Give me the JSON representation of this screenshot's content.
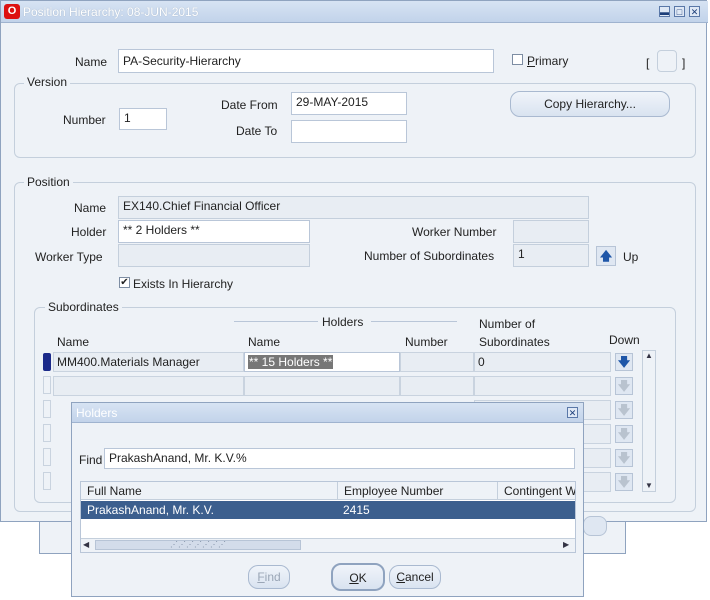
{
  "window": {
    "title": "Position Hierarchy: 08-JUN-2015"
  },
  "header": {
    "name_label": "Name",
    "name_value": "PA-Security-Hierarchy",
    "primary_label": "Primary",
    "primary_checked": false,
    "bracket_open": "[",
    "bracket_close": "]"
  },
  "version": {
    "title": "Version",
    "number_label": "Number",
    "number_value": "1",
    "date_from_label": "Date From",
    "date_from_value": "29-MAY-2015",
    "date_to_label": "Date To",
    "date_to_value": "",
    "copy_button": "Copy Hierarchy..."
  },
  "position": {
    "title": "Position",
    "name_label": "Name",
    "name_value": "EX140.Chief Financial Officer",
    "holder_label": "Holder",
    "holder_value": "** 2 Holders **",
    "worker_number_label": "Worker Number",
    "worker_number_value": "",
    "worker_type_label": "Worker Type",
    "worker_type_value": "",
    "subordinates_count_label": "Number of Subordinates",
    "subordinates_count_value": "1",
    "up_label": "Up",
    "exists_label": "Exists In Hierarchy",
    "exists_checked": true
  },
  "subordinates": {
    "title": "Subordinates",
    "holders_header": "Holders",
    "col_name": "Name",
    "col_holder_name": "Name",
    "col_number": "Number",
    "col_subs_line1": "Number of",
    "col_subs_line2": "Subordinates",
    "col_down": "Down",
    "rows": [
      {
        "name": "MM400.Materials Manager",
        "holder": "** 15 Holders **",
        "number": "",
        "subs": "0"
      }
    ]
  },
  "holders_dialog": {
    "title": "Holders",
    "find_label": "Find",
    "find_value": "PrakashAnand, Mr. K.V.%",
    "columns": [
      "Full Name",
      "Employee Number",
      "Contingent W"
    ],
    "rows": [
      {
        "full_name": "PrakashAnand, Mr. K.V.",
        "employee_number": "2415",
        "contingent": ""
      }
    ],
    "find_button": "Find",
    "ok_button": "OK",
    "cancel_button": "Cancel"
  }
}
